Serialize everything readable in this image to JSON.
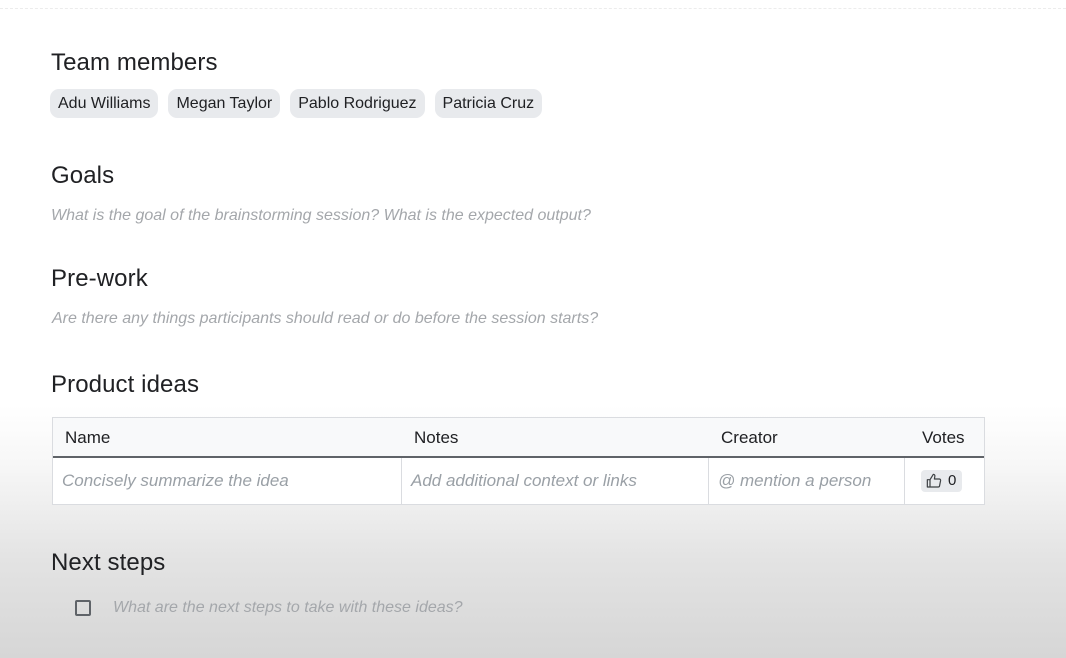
{
  "team": {
    "heading": "Team members",
    "members": [
      "Adu Williams",
      "Megan Taylor",
      "Pablo Rodriguez",
      "Patricia Cruz"
    ]
  },
  "goals": {
    "heading": "Goals",
    "placeholder": "What is the goal of the brainstorming session? What is the expected output?"
  },
  "prework": {
    "heading": "Pre-work",
    "placeholder": "Are there any things participants should read or do before the session starts?"
  },
  "ideas": {
    "heading": "Product ideas",
    "columns": [
      "Name",
      "Notes",
      "Creator",
      "Votes"
    ],
    "row": {
      "name_placeholder": "Concisely summarize the idea",
      "notes_placeholder": "Add additional context or links",
      "creator_placeholder": "@ mention a person",
      "votes": "0",
      "vote_icon": "thumbs-up-icon"
    }
  },
  "next_steps": {
    "heading": "Next steps",
    "placeholder": "What are the next steps to take with these ideas?",
    "checked": false
  }
}
